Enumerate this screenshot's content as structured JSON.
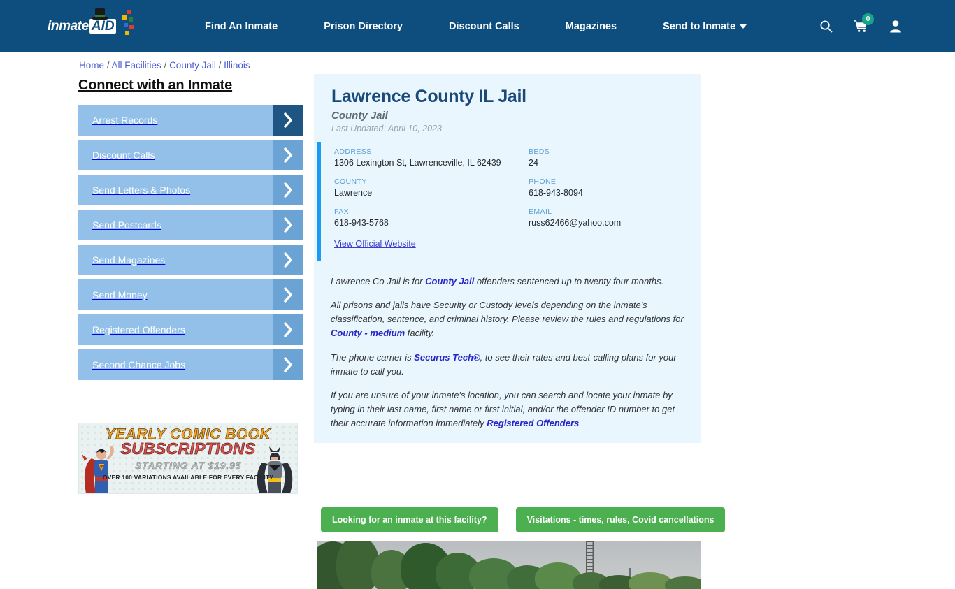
{
  "header": {
    "logo_word": "inmate",
    "logo_badge": "AID",
    "nav": [
      {
        "label": "Find An Inmate"
      },
      {
        "label": "Prison Directory"
      },
      {
        "label": "Discount Calls"
      },
      {
        "label": "Magazines"
      },
      {
        "label": "Send to Inmate"
      }
    ],
    "search_icon": "search-icon",
    "cart_icon": "cart-icon",
    "cart_count": "0",
    "account_icon": "user-icon",
    "brand_color": "#0d4e7e",
    "badge_color": "#17a589"
  },
  "breadcrumb": {
    "items": [
      {
        "label": "Home"
      },
      {
        "label": "All Facilities"
      },
      {
        "label": "County Jail"
      },
      {
        "label": "Illinois"
      }
    ],
    "separator": "/"
  },
  "sidebar": {
    "title": "Connect with an Inmate",
    "items": [
      {
        "label": "Arrest Records"
      },
      {
        "label": "Discount Calls"
      },
      {
        "label": "Send Letters & Photos"
      },
      {
        "label": "Send Postcards"
      },
      {
        "label": "Send Magazines"
      },
      {
        "label": "Send Money"
      },
      {
        "label": "Registered Offenders"
      },
      {
        "label": "Second Chance Jobs"
      }
    ]
  },
  "ad": {
    "title": "YEARLY COMIC BOOK",
    "subtitle": "SUBSCRIPTIONS",
    "price_line": "STARTING AT $19.95",
    "note": "OVER 100 VARIATIONS AVAILABLE FOR EVERY FACILITY"
  },
  "facility": {
    "name": "Lawrence County IL Jail",
    "type": "County Jail",
    "last_updated": "Last Updated: April 10, 2023",
    "fields": [
      {
        "label": "ADDRESS",
        "value": "1306 Lexington St, Lawrenceville, IL 62439"
      },
      {
        "label": "BEDS",
        "value": "24"
      },
      {
        "label": "COUNTY",
        "value": "Lawrence"
      },
      {
        "label": "PHONE",
        "value": "618-943-8094"
      },
      {
        "label": "FAX",
        "value": "618-943-5768"
      },
      {
        "label": "EMAIL",
        "value": "russ62466@yahoo.com"
      }
    ],
    "website_link": "View Official Website",
    "accent_color": "#1c9bf0"
  },
  "description": {
    "p1_a": "Lawrence Co Jail is for ",
    "p1_link": "County Jail",
    "p1_b": " offenders sentenced up to twenty four months.",
    "p2_a": "All prisons and jails have Security or Custody levels depending on the inmate's classification, sentence, and criminal history. Please review the rules and regulations for ",
    "p2_link": "County - medium",
    "p2_b": " facility.",
    "p3_a": "The phone carrier is ",
    "p3_link": "Securus Tech®",
    "p3_b": ", to see their rates and best-calling plans for your inmate to call you.",
    "p4_a": "If you are unsure of your inmate's location, you can search and locate your inmate by typing in their last name, first name or first initial, and/or the offender ID number to get their accurate information immediately ",
    "p4_link": "Registered Offenders"
  },
  "actions": {
    "inmate_search_label": "Looking for an inmate at this facility?",
    "visitation_label": "Visitations - times, rules, Covid cancellations",
    "button_color": "#4caf50"
  }
}
